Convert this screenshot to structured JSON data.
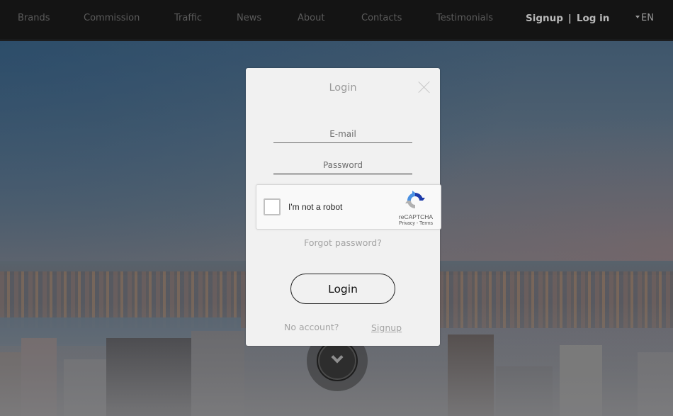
{
  "nav": {
    "items": [
      {
        "label": "Brands"
      },
      {
        "label": "Commission"
      },
      {
        "label": "Traffic"
      },
      {
        "label": "News"
      },
      {
        "label": "About"
      },
      {
        "label": "Contacts"
      },
      {
        "label": "Testimonials"
      }
    ],
    "signup_label": "Signup",
    "separator": "|",
    "login_label": "Log in",
    "language": "EN"
  },
  "modal": {
    "title": "Login",
    "email_placeholder": "E-mail",
    "password_placeholder": "Password",
    "recaptcha": {
      "label": "I'm not a robot",
      "brand": "reCAPTCHA",
      "privacy": "Privacy",
      "links_sep": " - ",
      "terms": "Terms"
    },
    "forgot_password": "Forgot password?",
    "login_button": "Login",
    "no_account": "No account?",
    "signup_link": "Signup"
  },
  "colors": {
    "navbar_bg": "#141414",
    "modal_bg": "#f1f1f1",
    "recaptcha_blue": "#4a90e2",
    "recaptcha_dark_blue": "#1c3aa9",
    "recaptcha_gray": "#b1b1b1"
  }
}
